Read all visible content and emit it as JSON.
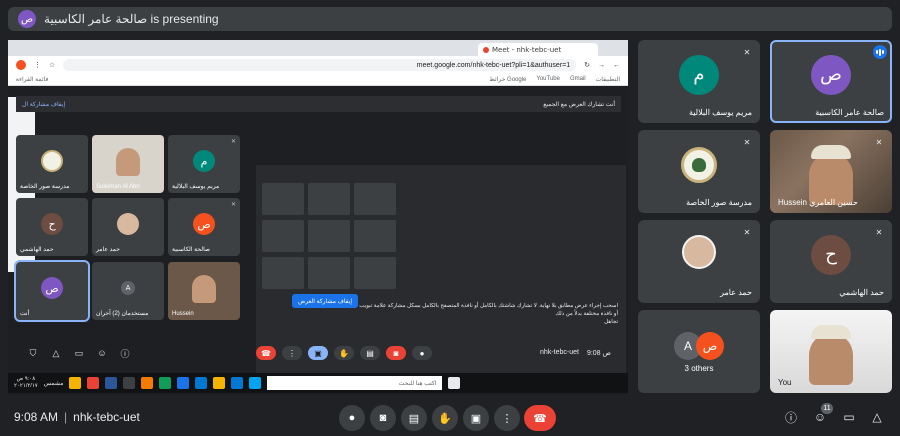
{
  "presenter": {
    "avatar": "ص",
    "text": "صالحة عامر الكاسبية is presenting"
  },
  "shared": {
    "tab_title": "Meet - nhk-tebc-uet",
    "url": "meet.google.com/nhk-tebc-uet?pli=1&authuser=1",
    "bookmarks": [
      "التطبيقات",
      "Gmail",
      "YouTube",
      "خرائط Google"
    ],
    "reading_list": "قائمة القراءة",
    "inner_presenting": "أنت تشارك العرض مع الجميع",
    "inner_stop": "إيقاف مشاركة ال",
    "inner_tiles": [
      {
        "name": "مريم يوسف البلالية",
        "avatar": "م",
        "color": "#00897b"
      },
      {
        "name": "Suleiman Al Abri",
        "avatar": "",
        "color": ""
      },
      {
        "name": "مدرسة صور الخاصة",
        "avatar": "",
        "color": ""
      },
      {
        "name": "صالحة الكاسبية",
        "avatar": "ص",
        "color": "#f4511e"
      },
      {
        "name": "حمد عامر",
        "avatar": "",
        "color": ""
      },
      {
        "name": "حمد الهاشمي",
        "avatar": "ح",
        "color": "#6d4c41"
      },
      {
        "name": "Hussein",
        "avatar": "",
        "color": ""
      },
      {
        "name": "مستخدمان (2) آخران",
        "avatar": "A",
        "color": "#5f6368"
      },
      {
        "name": "أنت",
        "avatar": "ص",
        "color": "#7e57c2"
      }
    ],
    "stop_button": "إيقاف مشاركة العرض",
    "note": "اسحب إجراء عرض مطابق بلا نهاية. لا تشارك شاشتك بالكامل أو نافذة المتصفح بالكامل بسكل مشاركة علامة تبويب أو نافذة مختلفة بدلاً من ذلك",
    "dismiss": "تجاهل",
    "meeting_code": "nhk-tebc-uet",
    "time": "9:08 ص",
    "people_count": "11",
    "taskbar_search": "اكتب هنا للبحث",
    "taskbar_time": "٩:٠٨ ص",
    "taskbar_date": "٢٠٢١/٢/١٧",
    "taskbar_user": "مشمس"
  },
  "tiles": [
    {
      "name": "صالحة عامر الكاسبية",
      "avatar": "ص",
      "color": "#7e57c2",
      "active": true
    },
    {
      "name": "مريم يوسف البلالية",
      "avatar": "م",
      "color": "#00897b",
      "active": false
    },
    {
      "name": "Hussein حسين العامري",
      "type": "photo",
      "active": false
    },
    {
      "name": "مدرسة صور الخاصة",
      "type": "emblem",
      "active": false
    },
    {
      "name": "حمد الهاشمي",
      "avatar": "ح",
      "color": "#6d4c41",
      "active": false
    },
    {
      "name": "حمد عامر",
      "type": "dish",
      "active": false
    },
    {
      "name": "You",
      "type": "photo-white",
      "active": false
    },
    {
      "name": "3 others",
      "avatars": [
        "ص",
        "A"
      ],
      "avatar_colors": [
        "#f4511e",
        "#5f6368"
      ],
      "active": false
    }
  ],
  "bottom": {
    "time": "9:08 AM",
    "separator": "|",
    "meeting_code": "nhk-tebc-uet",
    "people_count": "11"
  },
  "colors": {
    "background": "#202124",
    "tile": "#3c4043",
    "accent": "#8ab4f8",
    "end_call": "#ea4335"
  }
}
